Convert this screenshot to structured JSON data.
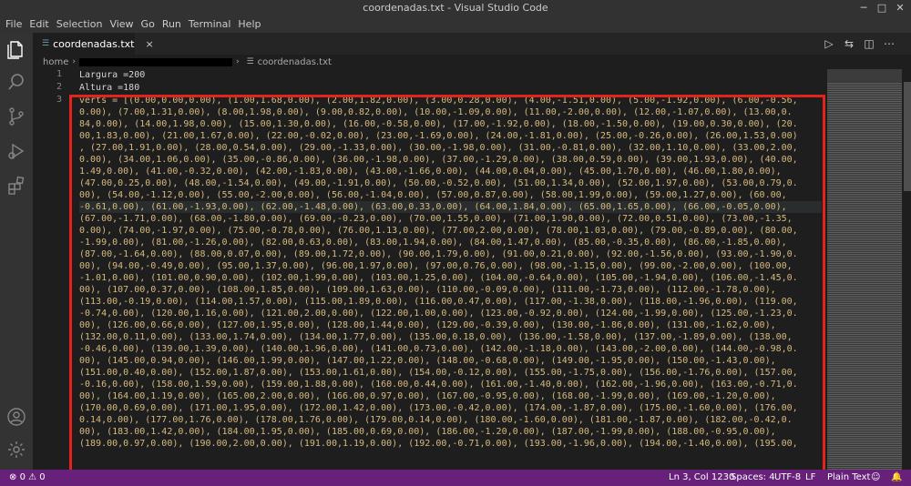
{
  "window": {
    "title": "coordenadas.txt - Visual Studio Code"
  },
  "menu": [
    "File",
    "Edit",
    "Selection",
    "View",
    "Go",
    "Run",
    "Terminal",
    "Help"
  ],
  "activity_bar": [
    "files-icon",
    "search-icon",
    "source-control-icon",
    "run-debug-icon",
    "extensions-icon",
    "account-icon",
    "settings-gear-icon"
  ],
  "tab": {
    "label": "coordenadas.txt",
    "close": "×"
  },
  "breadcrumb": {
    "root": "home",
    "file": "coordenadas.txt"
  },
  "editor": {
    "line_numbers": [
      "1",
      "2",
      "3"
    ],
    "lines": [
      "Largura =200",
      "Altura =180",
      "verts = [(0.00,0.00,0.00), (1.00,1.68,0.00), (2.00,1.82,0.00), (3.00,0.28,0.00), (4.00,-1.51,0.00), (5.00,-1.92,0.00), (6.00,-0.56,",
      "0.00), (7.00,1.31,0.00), (8.00,1.98,0.00), (9.00,0.82,0.00), (10.00,-1.09,0.00), (11.00,-2.00,0.00), (12.00,-1.07,0.00), (13.00,0.",
      "84,0.00), (14.00,1.98,0.00), (15.00,1.30,0.00), (16.00,-0.58,0.00), (17.00,-1.92,0.00), (18.00,-1.50,0.00), (19.00,0.30,0.00), (20.",
      "00,1.83,0.00), (21.00,1.67,0.00), (22.00,-0.02,0.00), (23.00,-1.69,0.00), (24.00,-1.81,0.00), (25.00,-0.26,0.00), (26.00,1.53,0.00)",
      ", (27.00,1.91,0.00), (28.00,0.54,0.00), (29.00,-1.33,0.00), (30.00,-1.98,0.00), (31.00,-0.81,0.00), (32.00,1.10,0.00), (33.00,2.00,",
      "0.00), (34.00,1.06,0.00), (35.00,-0.86,0.00), (36.00,-1.98,0.00), (37.00,-1.29,0.00), (38.00,0.59,0.00), (39.00,1.93,0.00), (40.00,",
      "1.49,0.00), (41.00,-0.32,0.00), (42.00,-1.83,0.00), (43.00,-1.66,0.00), (44.00,0.04,0.00), (45.00,1.70,0.00), (46.00,1.80,0.00),",
      "(47.00,0.25,0.00), (48.00,-1.54,0.00), (49.00,-1.91,0.00), (50.00,-0.52,0.00), (51.00,1.34,0.00), (52.00,1.97,0.00), (53.00,0.79,0.",
      "00), (54.00,-1.12,0.00), (55.00,-2.00,0.00), (56.00,-1.04,0.00), (57.00,0.87,0.00), (58.00,1.99,0.00), (59.00,1.27,0.00), (60.00,",
      "-0.61,0.00), (61.00,-1.93,0.00), (62.00,-1.48,0.00), (63.00,0.33,0.00), (64.00,1.84,0.00), (65.00,1.65,0.00), (66.00,-0.05,0.00),",
      "(67.00,-1.71,0.00), (68.00,-1.80,0.00), (69.00,-0.23,0.00), (70.00,1.55,0.00), (71.00,1.90,0.00), (72.00,0.51,0.00), (73.00,-1.35,",
      "0.00), (74.00,-1.97,0.00), (75.00,-0.78,0.00), (76.00,1.13,0.00), (77.00,2.00,0.00), (78.00,1.03,0.00), (79.00,-0.89,0.00), (80.00,",
      "-1.99,0.00), (81.00,-1.26,0.00), (82.00,0.63,0.00), (83.00,1.94,0.00), (84.00,1.47,0.00), (85.00,-0.35,0.00), (86.00,-1.85,0.00),",
      "(87.00,-1.64,0.00), (88.00,0.07,0.00), (89.00,1.72,0.00), (90.00,1.79,0.00), (91.00,0.21,0.00), (92.00,-1.56,0.00), (93.00,-1.90,0.",
      "00), (94.00,-0.49,0.00), (95.00,1.37,0.00), (96.00,1.97,0.00), (97.00,0.76,0.00), (98.00,-1.15,0.00), (99.00,-2.00,0.00), (100.00,",
      "-1.01,0.00), (101.00,0.90,0.00), (102.00,1.99,0.00), (103.00,1.25,0.00), (104.00,-0.64,0.00), (105.00,-1.94,0.00), (106.00,-1.45,0.",
      "00), (107.00,0.37,0.00), (108.00,1.85,0.00), (109.00,1.63,0.00), (110.00,-0.09,0.00), (111.00,-1.73,0.00), (112.00,-1.78,0.00),",
      "(113.00,-0.19,0.00), (114.00,1.57,0.00), (115.00,1.89,0.00), (116.00,0.47,0.00), (117.00,-1.38,0.00), (118.00,-1.96,0.00), (119.00,",
      "-0.74,0.00), (120.00,1.16,0.00), (121.00,2.00,0.00), (122.00,1.00,0.00), (123.00,-0.92,0.00), (124.00,-1.99,0.00), (125.00,-1.23,0.",
      "00), (126.00,0.66,0.00), (127.00,1.95,0.00), (128.00,1.44,0.00), (129.00,-0.39,0.00), (130.00,-1.86,0.00), (131.00,-1.62,0.00),",
      "(132.00,0.11,0.00), (133.00,1.74,0.00), (134.00,1.77,0.00), (135.00,0.18,0.00), (136.00,-1.58,0.00), (137.00,-1.89,0.00), (138.00,",
      "-0.46,0.00), (139.00,1.39,0.00), (140.00,1.96,0.00), (141.00,0.73,0.00), (142.00,-1.18,0.00), (143.00,-2.00,0.00), (144.00,-0.98,0.",
      "00), (145.00,0.94,0.00), (146.00,1.99,0.00), (147.00,1.22,0.00), (148.00,-0.68,0.00), (149.00,-1.95,0.00), (150.00,-1.43,0.00),",
      "(151.00,0.40,0.00), (152.00,1.87,0.00), (153.00,1.61,0.00), (154.00,-0.12,0.00), (155.00,-1.75,0.00), (156.00,-1.76,0.00), (157.00,",
      "-0.16,0.00), (158.00,1.59,0.00), (159.00,1.88,0.00), (160.00,0.44,0.00), (161.00,-1.40,0.00), (162.00,-1.96,0.00), (163.00,-0.71,0.",
      "00), (164.00,1.19,0.00), (165.00,2.00,0.00), (166.00,0.97,0.00), (167.00,-0.95,0.00), (168.00,-1.99,0.00), (169.00,-1.20,0.00),",
      "(170.00,0.69,0.00), (171.00,1.95,0.00), (172.00,1.42,0.00), (173.00,-0.42,0.00), (174.00,-1.87,0.00), (175.00,-1.60,0.00), (176.00,",
      "0.14,0.00), (177.00,1.76,0.00), (178.00,1.76,0.00), (179.00,0.14,0.00), (180.00,-1.60,0.00), (181.00,-1.87,0.00), (182.00,-0.42,0.",
      "00), (183.00,1.42,0.00), (184.00,1.95,0.00), (185.00,0.69,0.00), (186.00,-1.20,0.00), (187.00,-1.99,0.00), (188.00,-0.95,0.00),",
      "(189.00,0.97,0.00), (190.00,2.00,0.00), (191.00,1.19,0.00), (192.00,-0.71,0.00), (193.00,-1.96,0.00), (194.00,-1.40,0.00), (195.00,"
    ]
  },
  "status": {
    "errors": "0",
    "warnings": "0",
    "position": "Ln 3, Col 1230",
    "spaces": "Spaces: 4",
    "encoding": "UTF-8",
    "eol": "LF",
    "language": "Plain Text"
  },
  "colors": {
    "status_bar": "#68217a",
    "highlight_box": "#e2241d",
    "code_text": "#d7ba7d"
  }
}
